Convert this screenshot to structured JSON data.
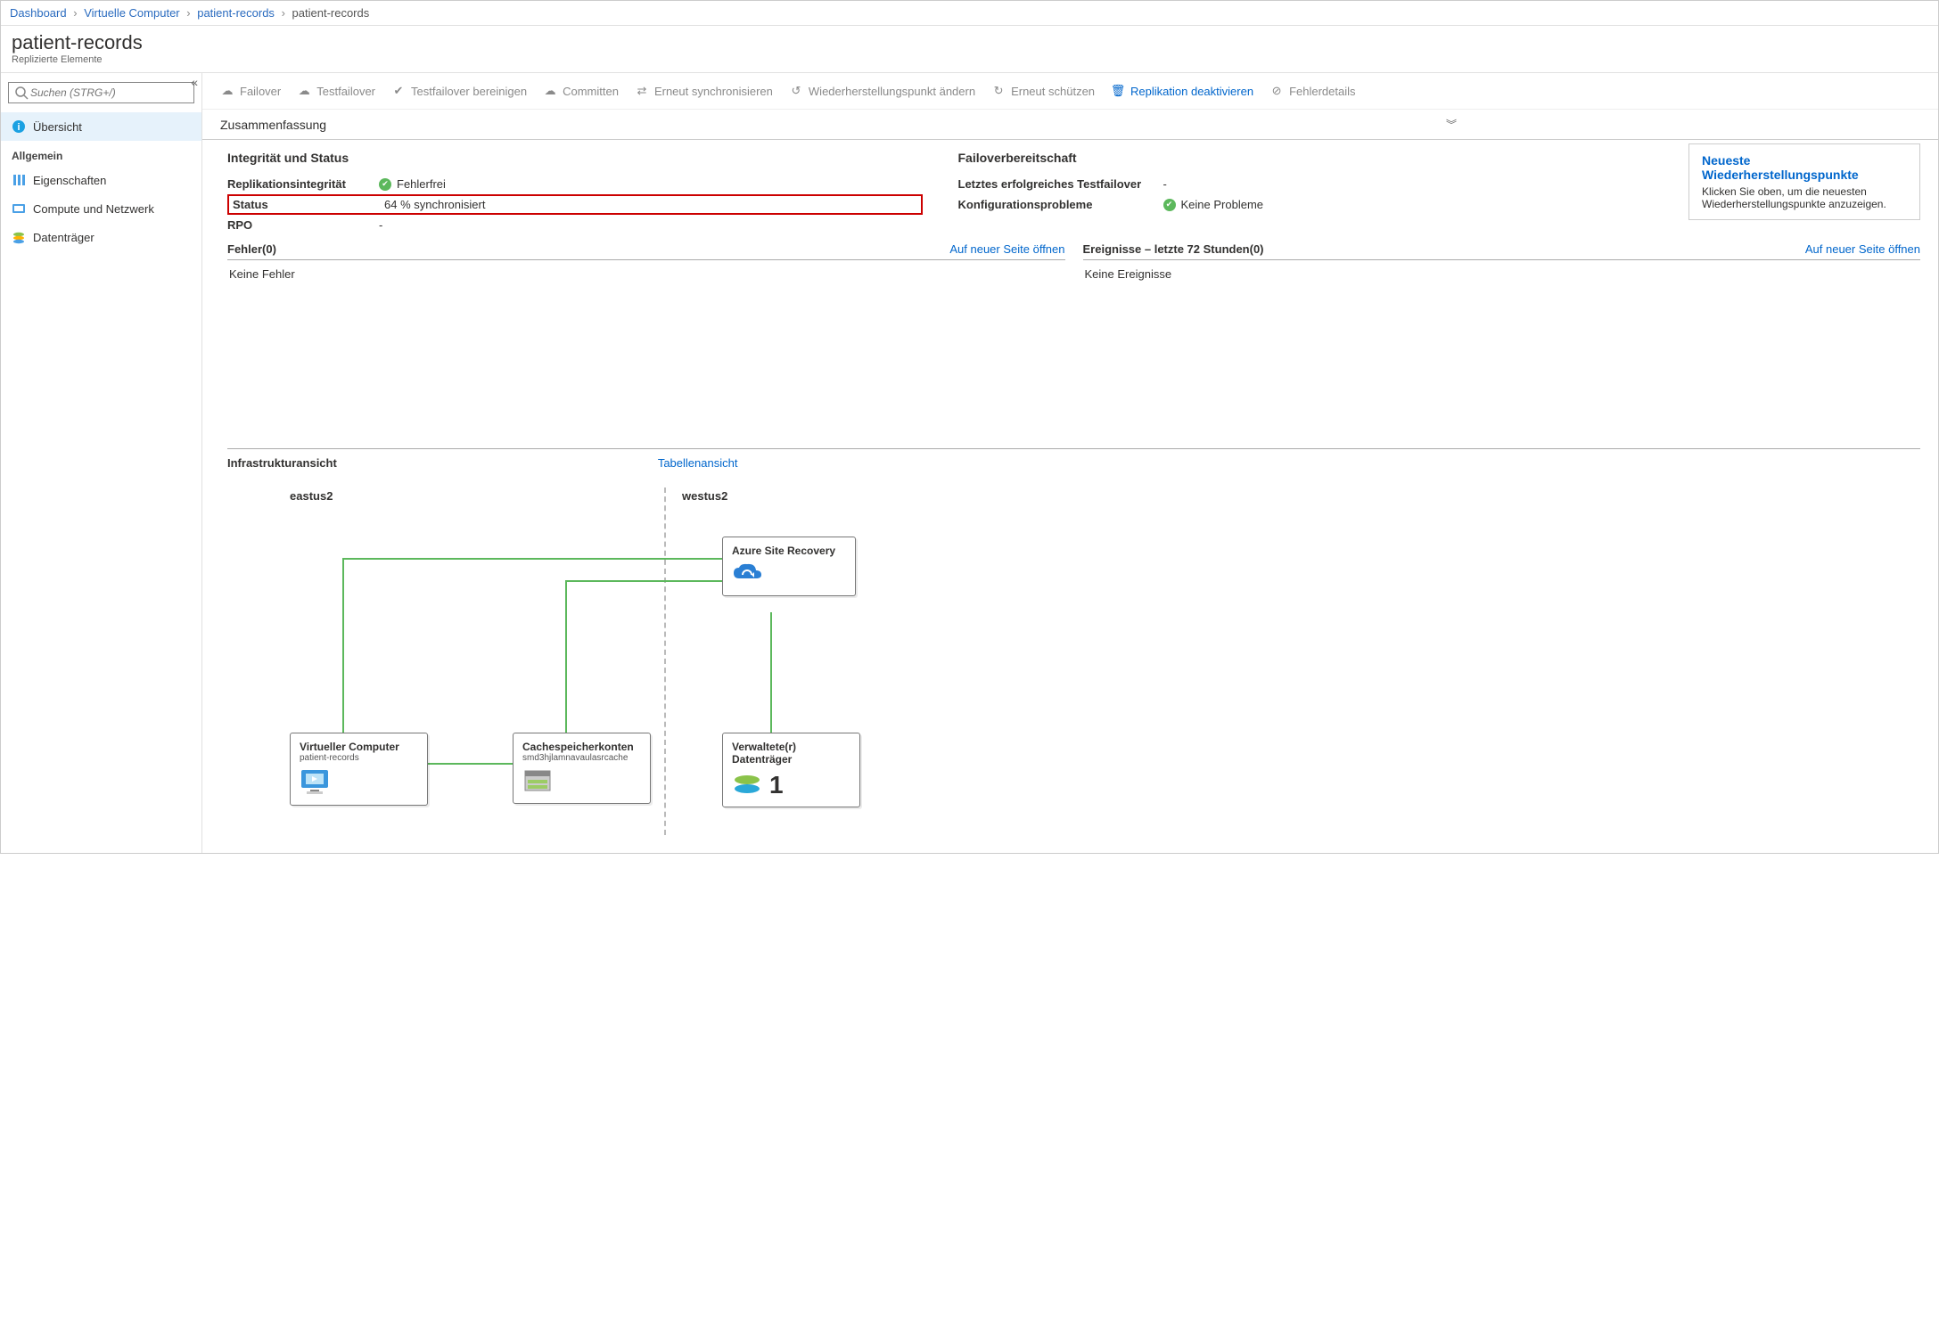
{
  "breadcrumb": [
    "Dashboard",
    "Virtuelle Computer",
    "patient-records",
    "patient-records"
  ],
  "header": {
    "title": "patient-records",
    "subtitle": "Replizierte Elemente"
  },
  "search": {
    "placeholder": "Suchen (STRG+/)"
  },
  "nav": {
    "overview": "Übersicht",
    "group": "Allgemein",
    "items": [
      "Eigenschaften",
      "Compute und Netzwerk",
      "Datenträger"
    ]
  },
  "toolbar": {
    "failover": "Failover",
    "testfailover": "Testfailover",
    "cleanup": "Testfailover bereinigen",
    "commit": "Committen",
    "resync": "Erneut synchronisieren",
    "changerp": "Wiederherstellungspunkt ändern",
    "reprotect": "Erneut schützen",
    "disable": "Replikation deaktivieren",
    "errdetail": "Fehlerdetails"
  },
  "summary": {
    "title": "Zusammenfassung",
    "integrity_header": "Integrität und Status",
    "repl_integrity_k": "Replikationsintegrität",
    "repl_integrity_v": "Fehlerfrei",
    "status_k": "Status",
    "status_v": "64 % synchronisiert",
    "rpo_k": "RPO",
    "rpo_v": "-",
    "fo_header": "Failoverbereitschaft",
    "last_testfo_k": "Letztes erfolgreiches Testfailover",
    "last_testfo_v": "-",
    "config_k": "Konfigurationsprobleme",
    "config_v": "Keine Probleme",
    "recovery_title": "Neueste Wiederherstellungspunkte",
    "recovery_text": "Klicken Sie oben, um die neuesten Wiederherstellungspunkte anzuzeigen."
  },
  "errors": {
    "title": "Fehler(0)",
    "link": "Auf neuer Seite öffnen",
    "body": "Keine Fehler"
  },
  "events": {
    "title": "Ereignisse – letzte 72 Stunden(0)",
    "link": "Auf neuer Seite öffnen",
    "body": "Keine Ereignisse"
  },
  "infra": {
    "title": "Infrastrukturansicht",
    "tablelink": "Tabellenansicht",
    "region_left": "eastus2",
    "region_right": "westus2",
    "node_vm_t": "Virtueller Computer",
    "node_vm_s": "patient-records",
    "node_cache_t": "Cachespeicherkonten",
    "node_cache_s": "smd3hjlamnavaulasrcache",
    "node_asr_t": "Azure Site Recovery",
    "node_disk_t": "Verwaltete(r) Datenträger",
    "node_disk_count": "1"
  }
}
